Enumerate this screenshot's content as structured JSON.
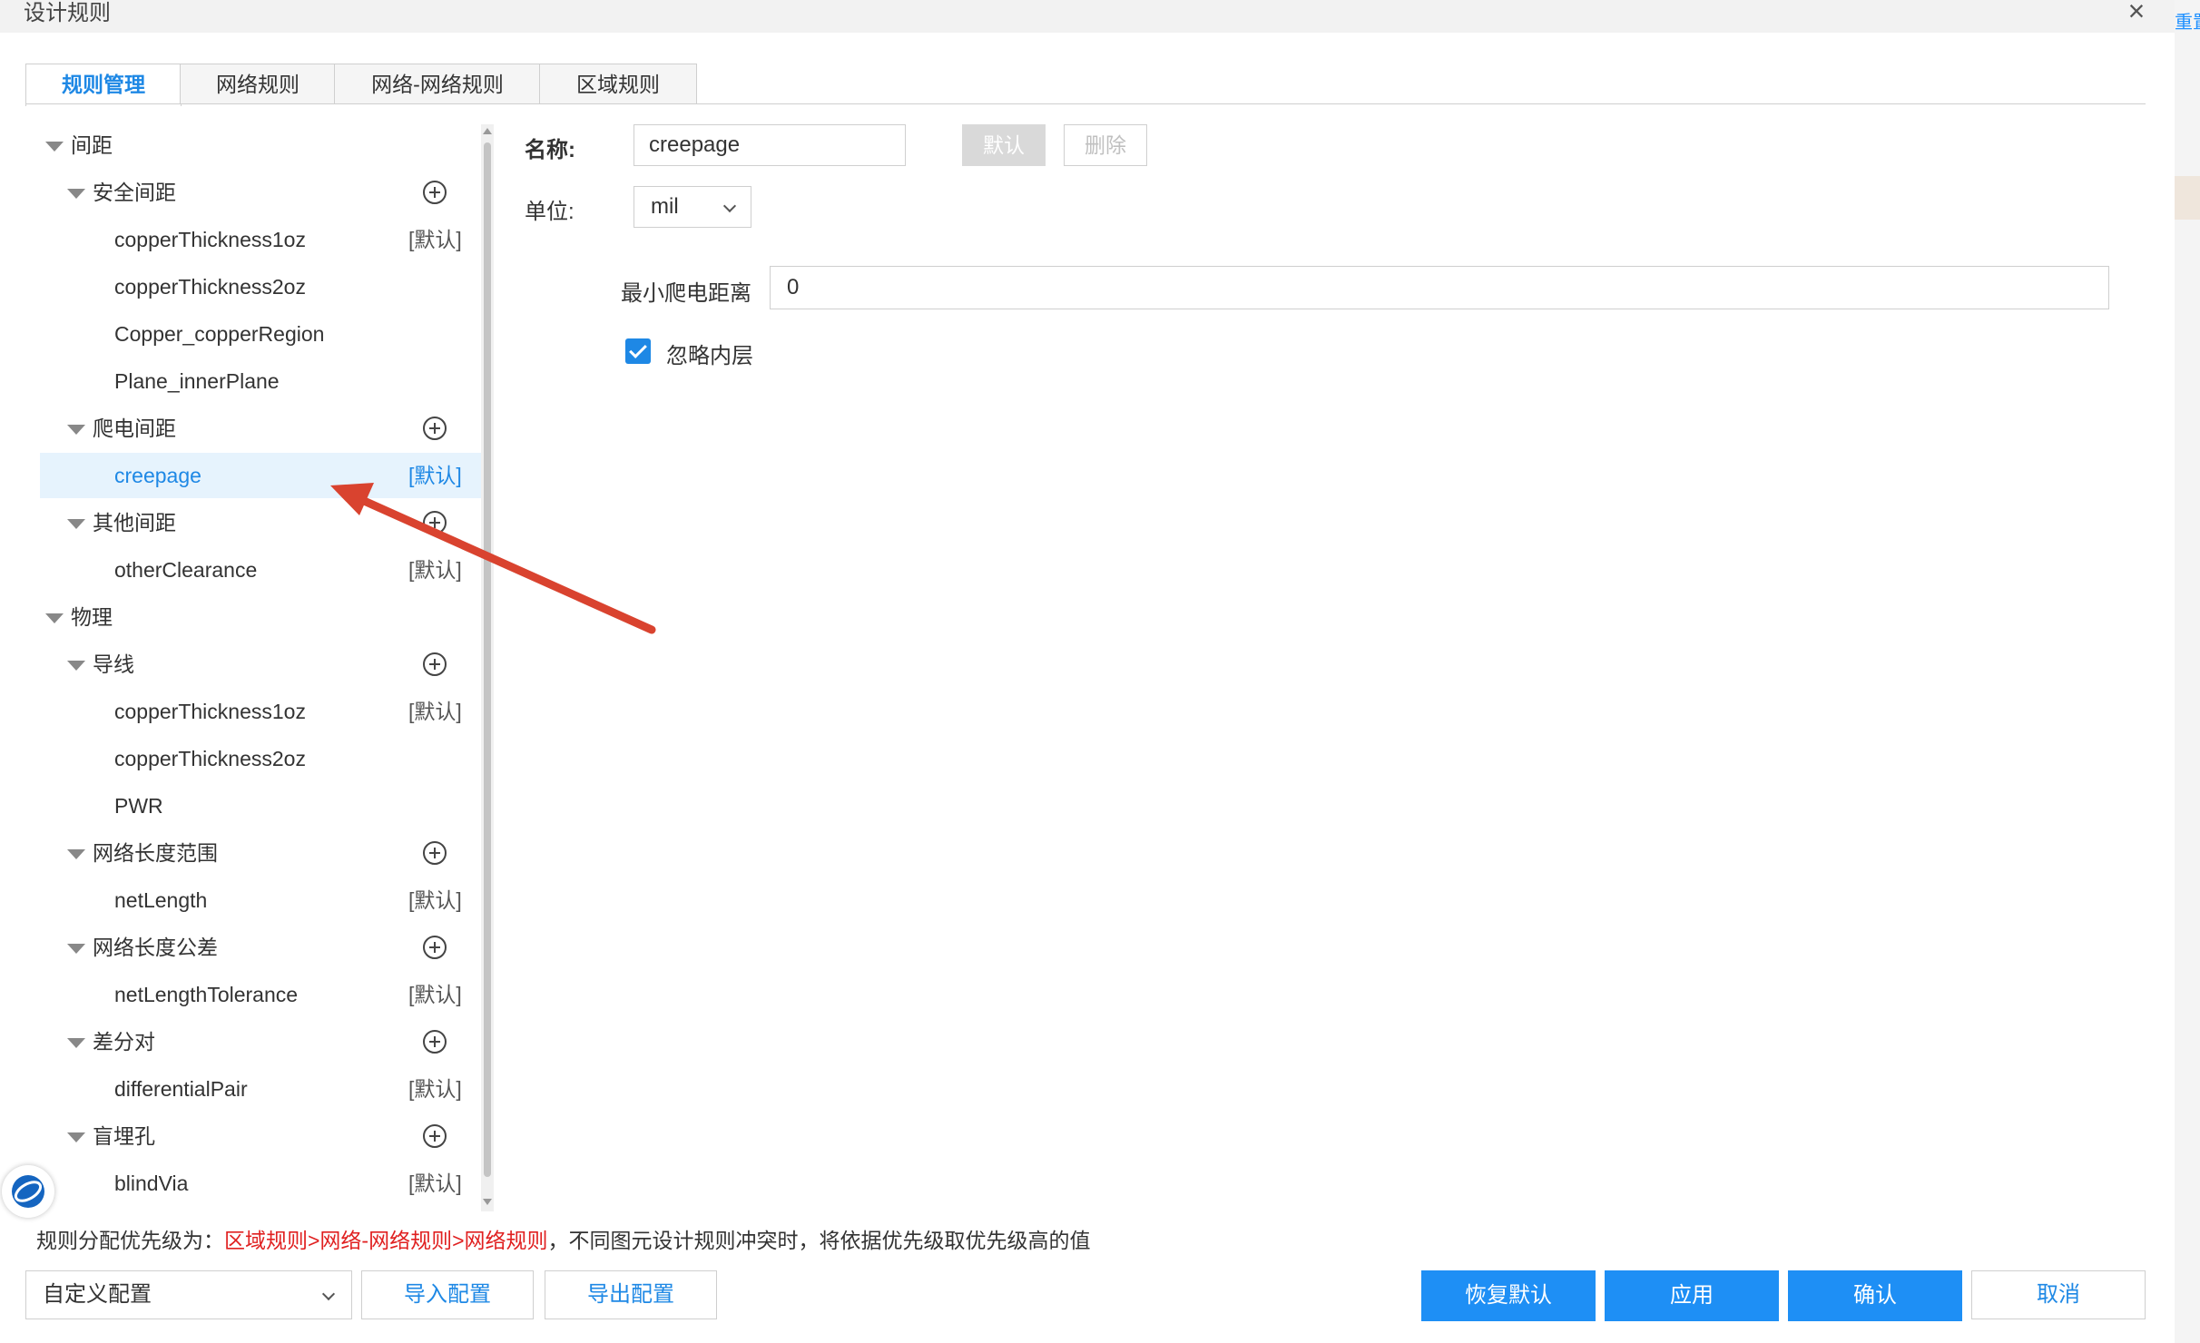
{
  "window": {
    "title": "设计规则"
  },
  "right_edge_text": "重置",
  "tabs": [
    {
      "label": "规则管理",
      "active": true
    },
    {
      "label": "网络规则",
      "active": false
    },
    {
      "label": "网络-网络规则",
      "active": false
    },
    {
      "label": "区域规则",
      "active": false
    }
  ],
  "tree": {
    "default_tag": "[默认]",
    "rows": [
      {
        "level": 0,
        "label": "间距",
        "caret": true
      },
      {
        "level": 1,
        "label": "安全间距",
        "caret": true,
        "add": true
      },
      {
        "level": 2,
        "label": "copperThickness1oz",
        "default": true
      },
      {
        "level": 2,
        "label": "copperThickness2oz"
      },
      {
        "level": 2,
        "label": "Copper_copperRegion"
      },
      {
        "level": 2,
        "label": "Plane_innerPlane"
      },
      {
        "level": 1,
        "label": "爬电间距",
        "caret": true,
        "add": true
      },
      {
        "level": 2,
        "label": "creepage",
        "default": true,
        "selected": true
      },
      {
        "level": 1,
        "label": "其他间距",
        "caret": true,
        "add": true
      },
      {
        "level": 2,
        "label": "otherClearance",
        "default": true
      },
      {
        "level": 0,
        "label": "物理",
        "caret": true
      },
      {
        "level": 1,
        "label": "导线",
        "caret": true,
        "add": true
      },
      {
        "level": 2,
        "label": "copperThickness1oz",
        "default": true
      },
      {
        "level": 2,
        "label": "copperThickness2oz"
      },
      {
        "level": 2,
        "label": "PWR"
      },
      {
        "level": 1,
        "label": "网络长度范围",
        "caret": true,
        "add": true
      },
      {
        "level": 2,
        "label": "netLength",
        "default": true
      },
      {
        "level": 1,
        "label": "网络长度公差",
        "caret": true,
        "add": true
      },
      {
        "level": 2,
        "label": "netLengthTolerance",
        "default": true
      },
      {
        "level": 1,
        "label": "差分对",
        "caret": true,
        "add": true
      },
      {
        "level": 2,
        "label": "differentialPair",
        "default": true
      },
      {
        "level": 1,
        "label": "盲埋孔",
        "caret": true,
        "add": true
      },
      {
        "level": 2,
        "label": "blindVia",
        "default": true
      }
    ]
  },
  "form": {
    "name_label": "名称:",
    "name_value": "creepage",
    "default_btn": "默认",
    "delete_btn": "删除",
    "unit_label": "单位:",
    "unit_value": "mil",
    "min_creepage_label": "最小爬电距离",
    "min_creepage_value": "0",
    "ignore_inner_label": "忽略内层",
    "ignore_inner_checked": true
  },
  "footer": {
    "priority_prefix": "规则分配优先级为：",
    "priority_order": "区域规则>网络-网络规则>网络规则",
    "priority_suffix": "，不同图元设计规则冲突时，将依据优先级取优先级高的值",
    "config_select": "自定义配置",
    "import_btn": "导入配置",
    "export_btn": "导出配置",
    "restore_btn": "恢复默认",
    "apply_btn": "应用",
    "confirm_btn": "确认",
    "cancel_btn": "取消"
  },
  "colors": {
    "accent": "#1e88e5",
    "primary_button": "#1e8ff5",
    "priority_red": "#e02020",
    "annotation_arrow": "#d9432f"
  }
}
